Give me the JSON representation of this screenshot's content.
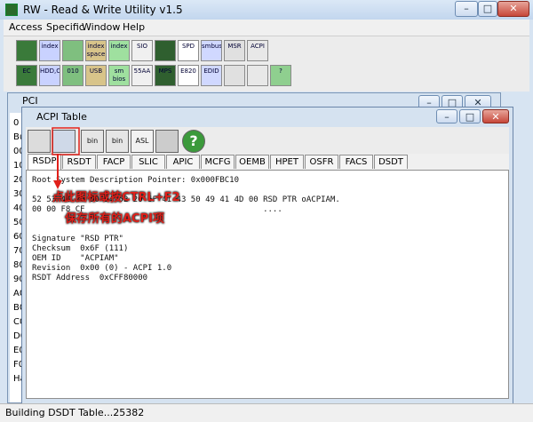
{
  "app": {
    "title": "RW - Read & Write Utility v1.5"
  },
  "menu": [
    "Access",
    "Specific",
    "Window",
    "Help"
  ],
  "toolbar_row1": [
    {
      "label": "",
      "icon": "floppy-icon"
    },
    {
      "label": "index",
      "icon": "index-icon"
    },
    {
      "label": "",
      "icon": "memory-icon"
    },
    {
      "label": "index space",
      "icon": "index-space-icon"
    },
    {
      "label": "index",
      "icon": "index-icon"
    },
    {
      "label": "SIO",
      "icon": "sio-icon"
    },
    {
      "label": "",
      "icon": "wave-icon"
    },
    {
      "label": "SPD",
      "icon": "spd-icon"
    },
    {
      "label": "smbus",
      "icon": "smbus-icon"
    },
    {
      "label": "MSR",
      "icon": "msr-icon"
    },
    {
      "label": "ACPI",
      "icon": "acpi-icon"
    }
  ],
  "toolbar_row2": [
    {
      "label": "EC",
      "icon": "ec-icon"
    },
    {
      "label": "HDD,CD",
      "icon": "hdd-icon"
    },
    {
      "label": "010",
      "icon": "binary-icon"
    },
    {
      "label": "USB",
      "icon": "usb-icon"
    },
    {
      "label": "sm bios",
      "icon": "smbios-icon"
    },
    {
      "label": "55AA",
      "icon": "rom-icon"
    },
    {
      "label": "MPS",
      "icon": "mps-icon"
    },
    {
      "label": "E820",
      "icon": "e820-icon"
    },
    {
      "label": "EDID",
      "icon": "edid-icon"
    },
    {
      "label": "",
      "icon": "terminal-icon"
    },
    {
      "label": "",
      "icon": "tools-icon"
    },
    {
      "label": "?",
      "icon": "help-icon"
    }
  ],
  "pci": {
    "title": "PCI",
    "rows": [
      "0",
      "Bu",
      "00",
      "10",
      "20",
      "30",
      "40",
      "50",
      "60",
      "70",
      "80",
      "90",
      "A0",
      "B0",
      "C0",
      "D0",
      "E0",
      "F0",
      "Har"
    ]
  },
  "acpi": {
    "title": "ACPI Table",
    "buttons": [
      {
        "label": "",
        "icon": "save-icon"
      },
      {
        "label": "",
        "icon": "save-all-icon"
      },
      {
        "label": "bin",
        "icon": "bin-icon"
      },
      {
        "label": "bin",
        "icon": "bin-all-icon"
      },
      {
        "label": "ASL",
        "icon": "asl-icon"
      },
      {
        "label": "",
        "icon": "binoculars-icon"
      },
      {
        "label": "?",
        "icon": "help-icon"
      }
    ],
    "tabs": [
      "RSDP",
      "RSDT",
      "FACP",
      "SLIC",
      "APIC",
      "MCFG",
      "OEMB",
      "HPET",
      "OSFR",
      "FACS",
      "DSDT"
    ],
    "active_tab": "RSDP",
    "lines": [
      "Root System Description Pointer: 0x000FBC10",
      "",
      "52 53 44 20 50 54 52 20 6F 41 43 50 49 41 4D 00 RSD PTR oACPIAM.",
      "00 00 F8 CF                                     ....",
      "",
      "",
      "Signature \"RSD PTR\"",
      "Checksum  0x6F (111)",
      "OEM ID    \"ACPIAM\"",
      "Revision  0x00 (0) - ACPI 1.0",
      "RSDT Address  0xCFF80000"
    ],
    "annotation": {
      "line1": "点此图标或按CTRL+F2",
      "line2": "保存所有的ACPI项",
      "color": "#e0201a"
    }
  },
  "status": {
    "text": "Building DSDT Table...25382"
  }
}
